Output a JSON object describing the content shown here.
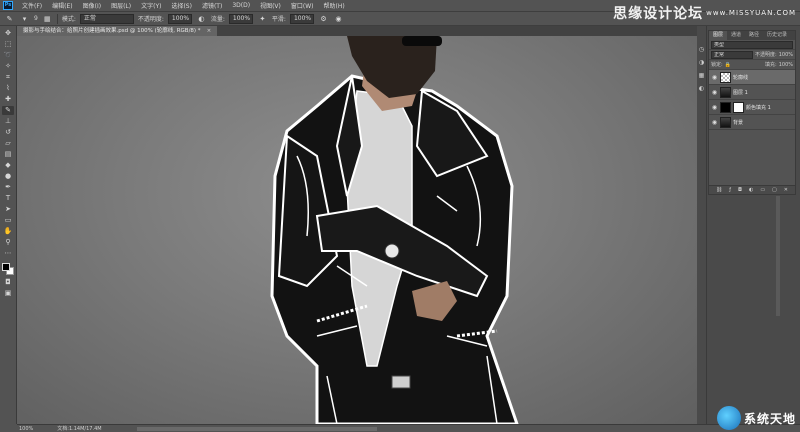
{
  "menubar": {
    "items": [
      "文件(F)",
      "编辑(E)",
      "图像(I)",
      "图层(L)",
      "文字(Y)",
      "选择(S)",
      "滤镜(T)",
      "3D(D)",
      "视图(V)",
      "窗口(W)",
      "帮助(H)"
    ]
  },
  "watermark_top": {
    "cn": "思缘设计论坛",
    "en": "www.MISSYUAN.COM"
  },
  "options": {
    "mode_label": "模式:",
    "mode_value": "正常",
    "opacity_label": "不透明度:",
    "opacity_value": "100%",
    "flow_label": "流量:",
    "flow_value": "100%",
    "smooth_label": "平滑:",
    "smooth_value": "100%",
    "brush_size": "9"
  },
  "document_tab": {
    "title": "摄影与手绘结合：给照片创建插画效果.psd @ 100% (轮廓线, RGB/8) *",
    "close": "×"
  },
  "layers_panel": {
    "tabs": [
      "图层",
      "通道",
      "路径",
      "历史记录"
    ],
    "kind_label": "类型",
    "blend_mode": "正常",
    "opacity_label": "不透明度:",
    "opacity_value": "100%",
    "lock_label": "锁定:",
    "fill_label": "填充:",
    "fill_value": "100%",
    "layers": [
      {
        "name": "轮廓线"
      },
      {
        "name": "图层 1"
      },
      {
        "name": "颜色填充 1"
      },
      {
        "name": "背景"
      }
    ],
    "footer_icons": [
      "link-icon",
      "fx-icon",
      "mask-icon",
      "adjustment-icon",
      "folder-icon",
      "new-layer-icon",
      "trash-icon"
    ]
  },
  "status": {
    "zoom": "100%",
    "doc": "文档:1.14M/17.4M"
  },
  "watermark_bottom": {
    "text": "系统天地"
  },
  "colors": {
    "ui_bg": "#535353",
    "accent": "#31a8ff",
    "outline": "#ffffff"
  }
}
